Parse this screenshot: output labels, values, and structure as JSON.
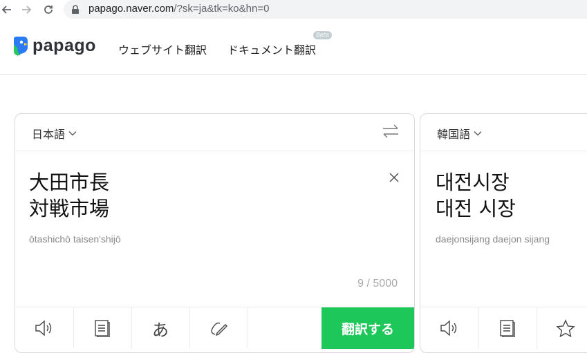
{
  "browser": {
    "url_host": "papago.naver.com",
    "url_path": "/?sk=ja&tk=ko&hn=0"
  },
  "header": {
    "logo_text": "papago",
    "nav": [
      {
        "label": "ウェブサイト翻訳"
      },
      {
        "label": "ドキュメント翻訳"
      }
    ],
    "beta_badge": "Beta"
  },
  "source": {
    "language": "日本語",
    "text": "大田市長\n対戦市場",
    "romanization": "ōtashichō taisen'shijō",
    "counter": "9 / 5000",
    "translate_button": "翻訳する"
  },
  "target": {
    "language": "韓国語",
    "text": "대전시장\n대전 시장",
    "romanization": "daejonsijang daejon sijang"
  },
  "colors": {
    "accent_green": "#1ec75a",
    "logo_blue": "#2a7bf4",
    "logo_green": "#27c95a"
  },
  "icons": {
    "speaker": "speaker-icon",
    "notebook": "notebook-icon",
    "hiragana": "あ",
    "handwriting": "handwriting-icon",
    "star": "star-icon"
  }
}
